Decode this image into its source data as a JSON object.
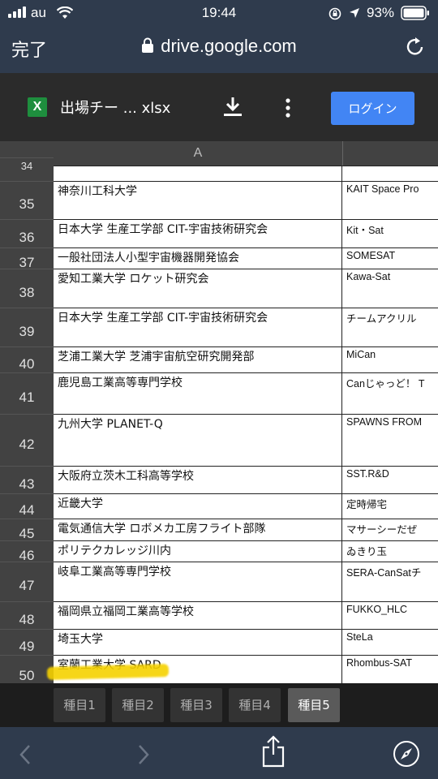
{
  "status": {
    "carrier": "au",
    "time": "19:44",
    "battery": "93%"
  },
  "browser": {
    "done_label": "完了",
    "url": "drive.google.com"
  },
  "toolbar": {
    "filename": "出場チー ... xlsx",
    "login_label": "ログイン"
  },
  "sheet": {
    "column_header": "A",
    "partial_row": "34",
    "rows": [
      {
        "n": "35",
        "a": "神奈川工科大学",
        "b": "KAIT Space Pro"
      },
      {
        "n": "36",
        "a": "日本大学 生産工学部 CIT-宇宙技術研究会",
        "b": "Kit・Sat"
      },
      {
        "n": "37",
        "a": "一般社団法人小型宇宙機器開発協会",
        "b": "SOMESAT"
      },
      {
        "n": "38",
        "a": "愛知工業大学 ロケット研究会",
        "b": "Kawa-Sat"
      },
      {
        "n": "39",
        "a": "日本大学 生産工学部 CIT-宇宙技術研究会",
        "b": "チームアクリル"
      },
      {
        "n": "40",
        "a": "芝浦工業大学 芝浦宇宙航空研究開発部",
        "b": "MiCan"
      },
      {
        "n": "41",
        "a": "鹿児島工業高等専門学校",
        "b": "Canじゃっど！ T"
      },
      {
        "n": "42",
        "a": "九州大学 PLANET-Q",
        "b": "SPAWNS FROM"
      },
      {
        "n": "43",
        "a": "大阪府立茨木工科高等学校",
        "b": "SST.R&D"
      },
      {
        "n": "44",
        "a": "近畿大学",
        "b": "定時帰宅"
      },
      {
        "n": "45",
        "a": "電気通信大学 ロボメカ工房フライト部隊",
        "b": "マサーシーだぜ"
      },
      {
        "n": "46",
        "a": "ポリテクカレッジ川内",
        "b": "ゐきり玉"
      },
      {
        "n": "47",
        "a": "岐阜工業高等専門学校",
        "b": "SERA-CanSatチ"
      },
      {
        "n": "48",
        "a": "福岡県立福岡工業高等学校",
        "b": "FUKKO_HLC"
      },
      {
        "n": "49",
        "a": "埼玉大学",
        "b": "SteLa"
      },
      {
        "n": "50",
        "a": "室蘭工業大学 SARD",
        "b": "Rhombus-SAT"
      }
    ]
  },
  "tabs": [
    "種目1",
    "種目2",
    "種目3",
    "種目4",
    "種目5"
  ],
  "active_tab": "種目5",
  "colors": {
    "login": "#4285f4",
    "excel_green": "#1e8e3e",
    "highlight": "#f6d200"
  }
}
